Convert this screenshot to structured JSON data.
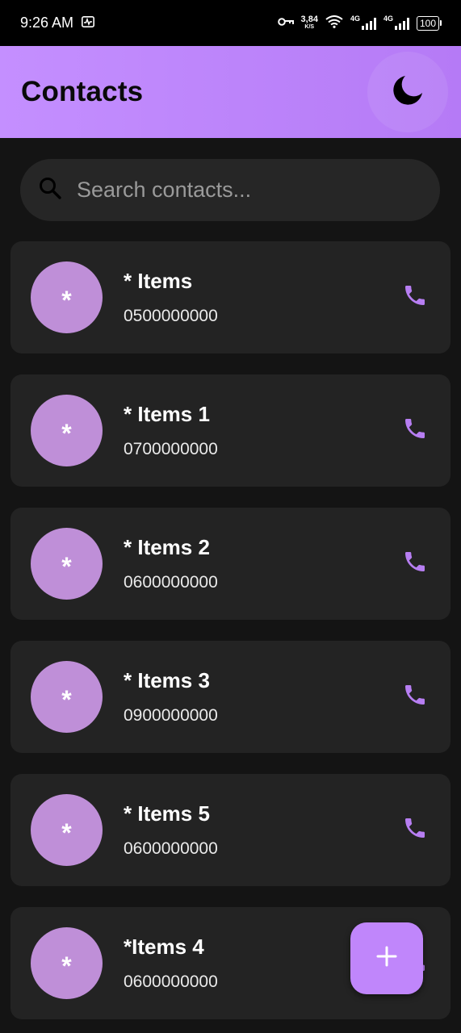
{
  "status_bar": {
    "time": "9:26 AM",
    "net_speed_value": "3,84",
    "net_speed_unit": "K/S",
    "sim1_tag": "4G",
    "sim2_tag": "4G",
    "battery": "100"
  },
  "app_bar": {
    "title": "Contacts",
    "theme_icon": "moon-icon"
  },
  "search": {
    "placeholder": "Search contacts...",
    "value": ""
  },
  "contacts": [
    {
      "avatar": "*",
      "name": "* Items",
      "phone": "0500000000"
    },
    {
      "avatar": "*",
      "name": "* Items 1",
      "phone": "0700000000"
    },
    {
      "avatar": "*",
      "name": "* Items 2",
      "phone": "0600000000"
    },
    {
      "avatar": "*",
      "name": "* Items 3",
      "phone": "0900000000"
    },
    {
      "avatar": "*",
      "name": "* Items 5",
      "phone": "0600000000"
    },
    {
      "avatar": "*",
      "name": "*Items 4",
      "phone": "0600000000"
    }
  ],
  "fab": {
    "icon": "plus-icon"
  },
  "colors": {
    "accent": "#c086fb",
    "app_bar": "#c48fff",
    "avatar": "#bf8fd8",
    "background": "#141414",
    "card": "#232323"
  }
}
